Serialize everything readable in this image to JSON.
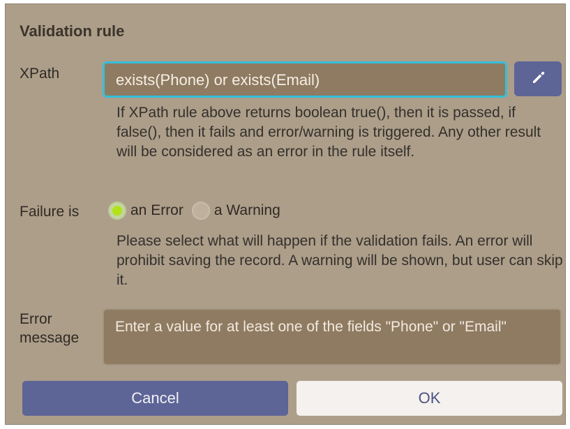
{
  "dialog": {
    "title": "Validation rule",
    "xpath": {
      "label": "XPath",
      "value": "exists(Phone) or exists(Email)",
      "edit_icon": "pencil-icon",
      "help": "If XPath rule above returns boolean true(), then it is passed, if false(), then it fails and error/warning is triggered. Any other result will be considered as an error in the rule itself."
    },
    "failure": {
      "label": "Failure is",
      "options": [
        {
          "label": "an Error",
          "checked": true
        },
        {
          "label": "a Warning",
          "checked": false
        }
      ],
      "help": "Please select what will happen if the validation fails. An error will prohibit saving the record. A warning will be shown, but user can skip it."
    },
    "error_message": {
      "label": "Error message",
      "value": "Enter a value for at least one of the fields \"Phone\" or \"Email\""
    },
    "buttons": {
      "cancel": "Cancel",
      "ok": "OK"
    }
  },
  "colors": {
    "dialog_bg": "#ad9e8a",
    "input_bg": "#8f7b62",
    "focus_border": "#35bfd8",
    "primary_button": "#5d6496",
    "secondary_button": "#f4f1ee",
    "radio_checked": "#b2e21a"
  }
}
